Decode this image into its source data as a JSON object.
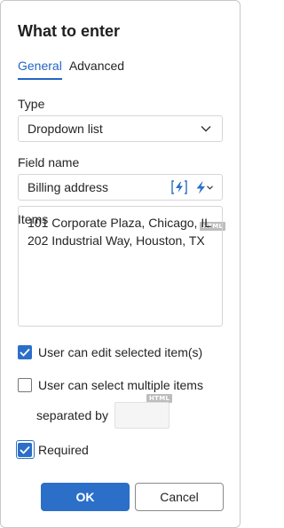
{
  "dialog": {
    "title": "What to enter"
  },
  "tabs": [
    {
      "label": "General",
      "active": true
    },
    {
      "label": "Advanced",
      "active": false
    }
  ],
  "type_field": {
    "label": "Type",
    "value": "Dropdown list",
    "icon": "chevron-down-icon"
  },
  "field_name": {
    "label": "Field name",
    "value": "Billing address",
    "icons": [
      "bolt-box-icon",
      "bolt-dropdown-icon"
    ]
  },
  "items_field": {
    "label": "Items",
    "badge": "HTML",
    "value": "101 Corporate Plaza, Chicago, IL\n202 Industrial Way, Houston, TX"
  },
  "options": {
    "user_can_edit": {
      "label": "User can edit selected item(s)",
      "checked": true
    },
    "multiple": {
      "label": "User can select multiple items",
      "checked": false
    },
    "separated_by": {
      "label": "separated by",
      "badge": "HTML",
      "value": ""
    },
    "required": {
      "label": "Required",
      "checked": true
    }
  },
  "buttons": {
    "ok": "OK",
    "cancel": "Cancel"
  },
  "colors": {
    "accent": "#2b6fc9",
    "tab_active": "#2266c4"
  }
}
